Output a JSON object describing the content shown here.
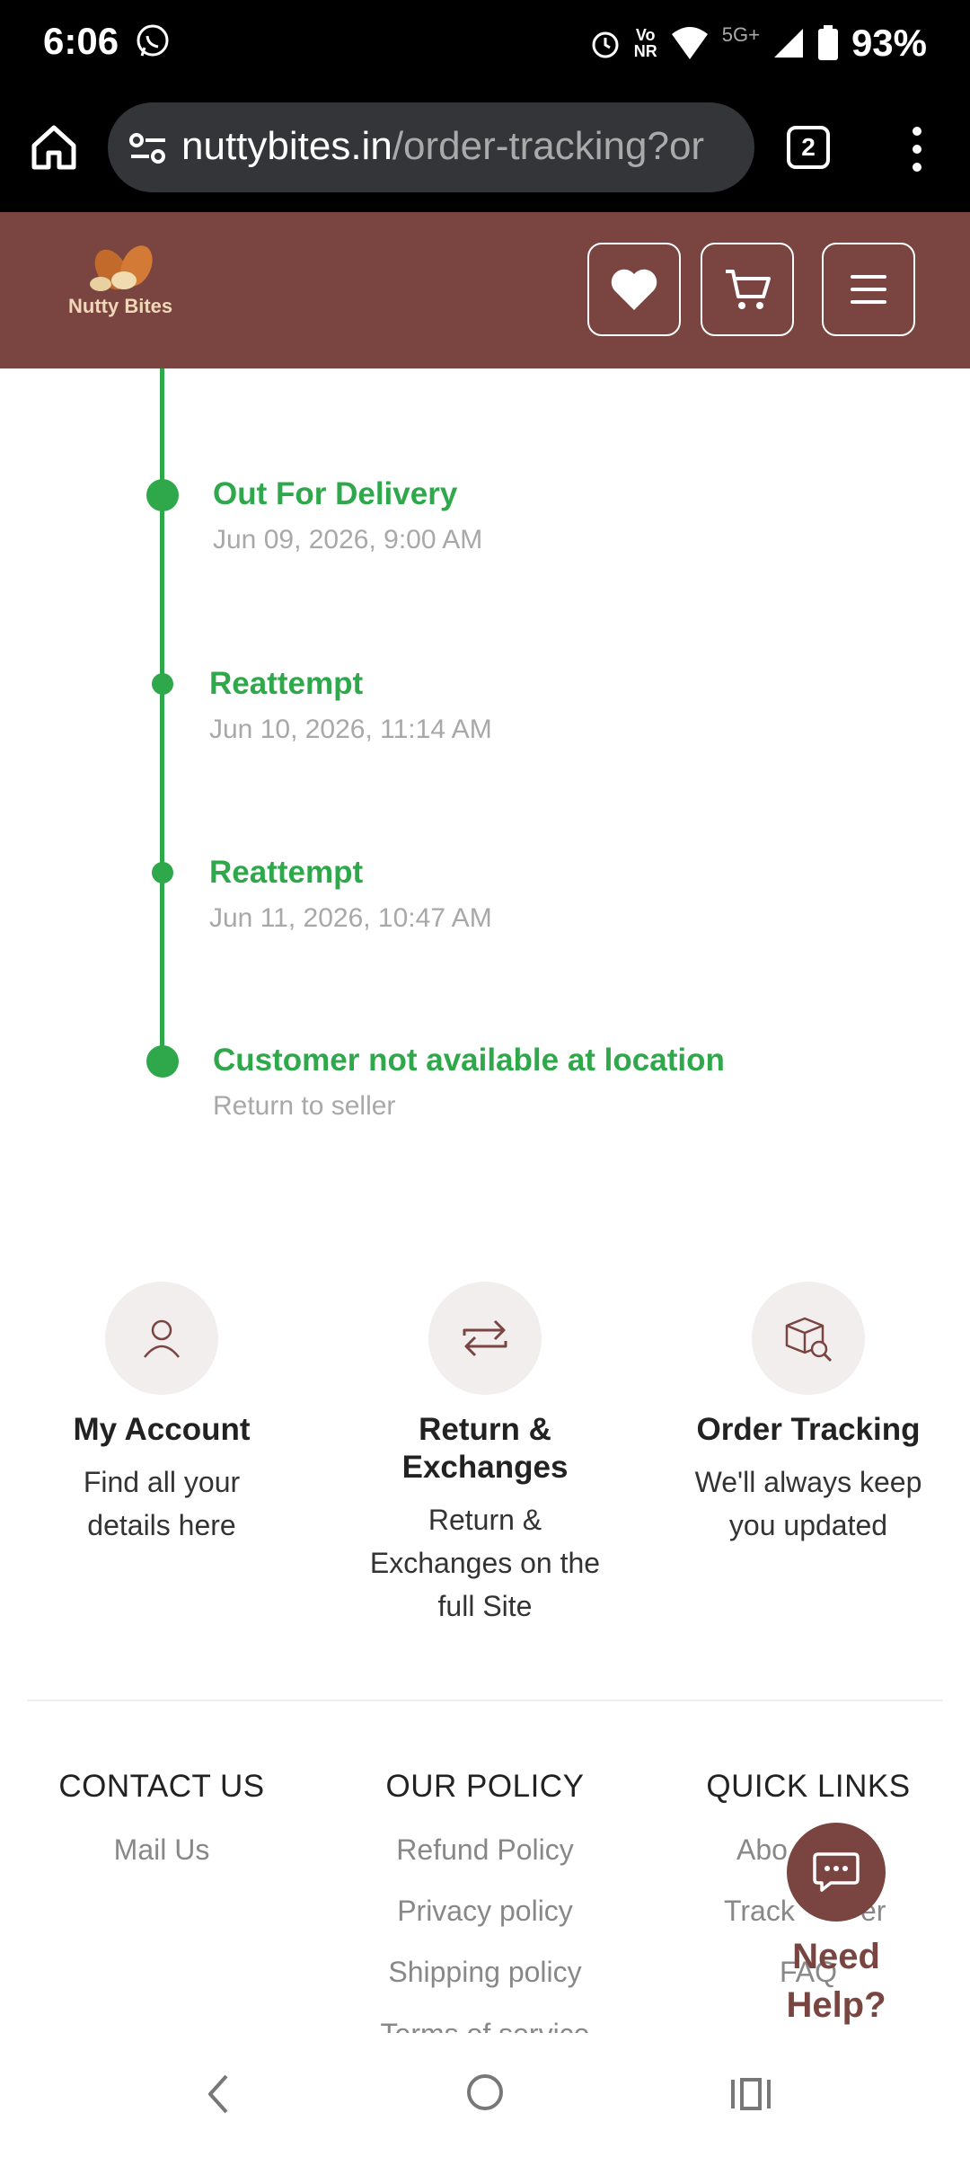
{
  "status_bar": {
    "time": "6:06",
    "network_top": "Vo",
    "network_bottom": "NR",
    "signal_5g": "5G+",
    "battery": "93%"
  },
  "browser": {
    "url_domain": "nuttybites.in",
    "url_path": "/order-tracking?or",
    "tab_count": "2"
  },
  "site_header": {
    "logo_text": "Nutty Bites",
    "wishlist_icon": "heart-icon",
    "cart_icon": "cart-icon",
    "menu_icon": "hamburger-icon",
    "brand_color": "#7a4540"
  },
  "timeline": {
    "accent_color": "#2ea84a",
    "events": [
      {
        "title": "Out For Delivery",
        "subtitle": "Jun 09, 2026, 9:00 AM"
      },
      {
        "title": "Reattempt",
        "subtitle": "Jun 10, 2026, 11:14 AM"
      },
      {
        "title": "Reattempt",
        "subtitle": "Jun 11, 2026, 10:47 AM"
      },
      {
        "title": "Customer not available at location",
        "subtitle": "Return to seller"
      }
    ]
  },
  "features": [
    {
      "icon": "user-icon",
      "title": "My Account",
      "desc_line1": "Find all your",
      "desc_line2": "details here"
    },
    {
      "icon": "exchange-icon",
      "title_line1": "Return &",
      "title_line2": "Exchanges",
      "desc_line1": "Return &",
      "desc_line2": "Exchanges on the",
      "desc_line3": "full Site"
    },
    {
      "icon": "package-search-icon",
      "title": "Order Tracking",
      "desc_line1": "We'll always keep",
      "desc_line2": "you updated"
    }
  ],
  "footer": {
    "contact": {
      "heading": "CONTACT US",
      "links": [
        "Mail Us"
      ]
    },
    "policy": {
      "heading": "OUR POLICY",
      "links": [
        "Refund Policy",
        "Privacy policy",
        "Shipping policy",
        "Terms of service"
      ]
    },
    "quick": {
      "heading": "QUICK LINKS",
      "links": [
        "Abo",
        "Track",
        "er",
        "FAQ"
      ]
    }
  },
  "help": {
    "line1": "Need",
    "line2": "Help?",
    "icon": "chat-icon"
  },
  "navbar": {
    "back_icon": "back-icon",
    "home_icon": "home-circle-icon",
    "recent_icon": "recents-icon"
  }
}
